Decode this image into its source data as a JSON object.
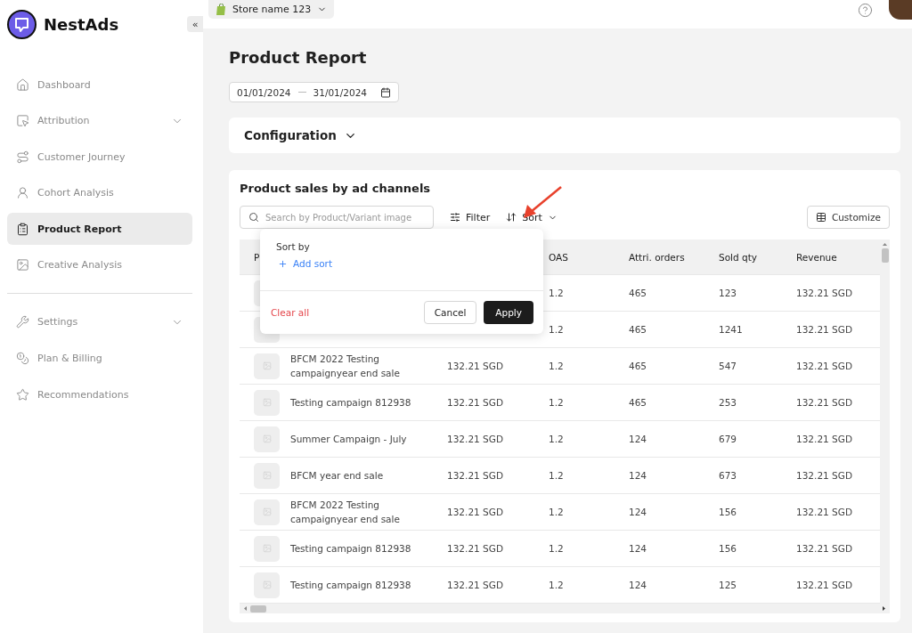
{
  "sidebar": {
    "brand": "NestAds",
    "collapse": "«",
    "groups": [
      [
        {
          "label": "Dashboard",
          "selected": false,
          "expandable": false
        },
        {
          "label": "Attribution",
          "selected": false,
          "expandable": true
        },
        {
          "label": "Customer Journey",
          "selected": false,
          "expandable": false
        },
        {
          "label": "Cohort Analysis",
          "selected": false,
          "expandable": false
        },
        {
          "label": "Product Report",
          "selected": true,
          "expandable": false
        },
        {
          "label": "Creative Analysis",
          "selected": false,
          "expandable": false
        }
      ],
      [
        {
          "label": "Settings",
          "selected": false,
          "expandable": true
        },
        {
          "label": "Plan & Billing",
          "selected": false,
          "expandable": false
        },
        {
          "label": "Recommendations",
          "selected": false,
          "expandable": false
        }
      ]
    ]
  },
  "topbar": {
    "store": "Store name 123"
  },
  "page": {
    "title": "Product Report",
    "date_from": "01/01/2024",
    "date_to": "31/01/2024",
    "configuration": "Configuration"
  },
  "report": {
    "title": "Product sales by ad channels",
    "search": {
      "placeholder": "Search by Product/Variant image"
    },
    "filter": "Filter",
    "sort": "Sort",
    "customize": "Customize",
    "sort_popover": {
      "title": "Sort by",
      "add": "Add sort",
      "clear": "Clear all",
      "cancel": "Cancel",
      "apply": "Apply"
    },
    "columns": [
      "P",
      null,
      "OAS",
      "Attri. orders",
      "Sold qty",
      "Revenue"
    ],
    "rows": [
      [
        null,
        null,
        "1.2",
        "465",
        "123",
        "132.21 SGD"
      ],
      [
        null,
        null,
        "1.2",
        "465",
        "1241",
        "132.21 SGD"
      ],
      [
        "BFCM 2022 Testing campaignyear end sale",
        "132.21 SGD",
        "1.2",
        "465",
        "547",
        "132.21 SGD"
      ],
      [
        "Testing campaign 812938",
        "132.21 SGD",
        "1.2",
        "465",
        "253",
        "132.21 SGD"
      ],
      [
        "Summer Campaign - July",
        "132.21 SGD",
        "1.2",
        "124",
        "679",
        "132.21 SGD"
      ],
      [
        "BFCM year end sale",
        "132.21 SGD",
        "1.2",
        "124",
        "673",
        "132.21 SGD"
      ],
      [
        "BFCM 2022 Testing campaignyear end sale",
        "132.21 SGD",
        "1.2",
        "124",
        "156",
        "132.21 SGD"
      ],
      [
        "Testing campaign 812938",
        "132.21 SGD",
        "1.2",
        "124",
        "156",
        "132.21 SGD"
      ],
      [
        "Testing campaign 812938",
        "132.21 SGD",
        "1.2",
        "124",
        "125",
        "132.21 SGD"
      ]
    ]
  }
}
